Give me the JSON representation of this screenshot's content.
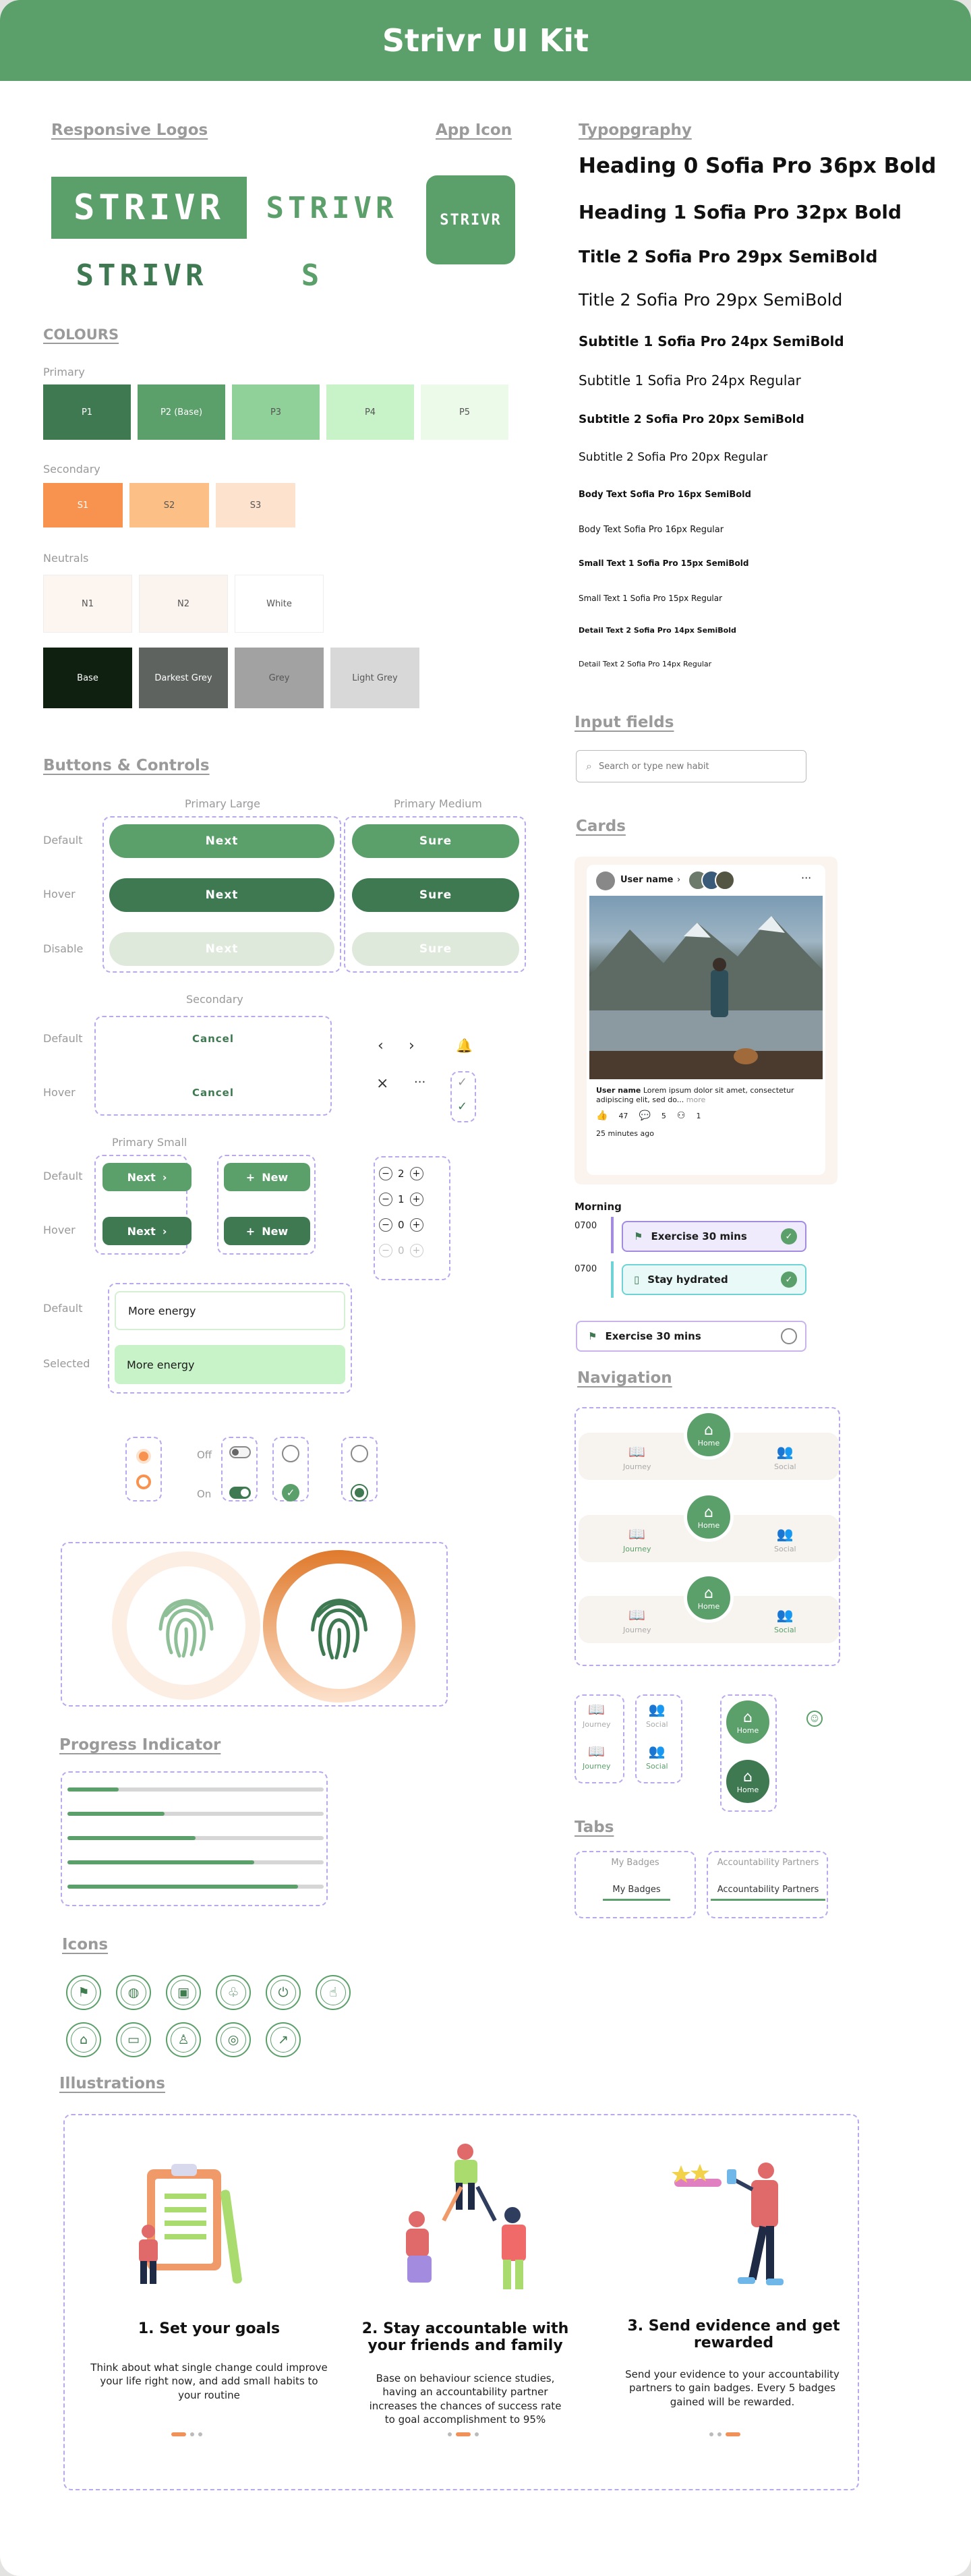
{
  "title": "Strivr UI Kit",
  "colors": {
    "brand": "#5b9f6a",
    "brand_dark": "#3f7d4e",
    "outline": "#b9a8ec"
  },
  "sections": {
    "responsive_logos": "Responsive Logos",
    "app_icon": "App Icon",
    "colours": "COLOURS",
    "typography": "Typopgraphy",
    "buttons": "Buttons & Controls",
    "input_fields": "Input fields",
    "cards": "Cards",
    "navigation": "Navigation",
    "tabs": "Tabs",
    "progress": "Progress Indicator",
    "icons": "Icons",
    "illustrations": "Illustrations"
  },
  "logos": {
    "full": "STRIVR",
    "small": "S"
  },
  "colour_groups": {
    "primary": "Primary",
    "secondary": "Secondary",
    "neutrals": "Neutrals"
  },
  "swatches": {
    "primary": [
      {
        "label": "P1",
        "color": "#3e7952"
      },
      {
        "label": "P2 (Base)",
        "color": "#5b9f6a"
      },
      {
        "label": "P3",
        "color": "#90d199"
      },
      {
        "label": "P4",
        "color": "#c8f3c8"
      },
      {
        "label": "P5",
        "color": "#ecfbe9"
      }
    ],
    "secondary": [
      {
        "label": "S1",
        "color": "#f8924f"
      },
      {
        "label": "S2",
        "color": "#fcc087"
      },
      {
        "label": "S3",
        "color": "#fde2cd"
      }
    ],
    "neutrals": [
      {
        "label": "N1",
        "color": "#fdf5f0"
      },
      {
        "label": "N2",
        "color": "#fbf3ee"
      },
      {
        "label": "White",
        "color": "#ffffff"
      }
    ],
    "neutrals_dark": [
      {
        "label": "Base",
        "color": "#0f1f10"
      },
      {
        "label": "Darkest Grey",
        "color": "#5f6360"
      },
      {
        "label": "Grey",
        "color": "#a2a2a2"
      },
      {
        "label": "Light Grey",
        "color": "#d8d8d8"
      }
    ]
  },
  "typography": [
    "Heading 0 Sofia Pro 36px Bold",
    "Heading 1 Sofia Pro 32px Bold",
    "Title 2 Sofia Pro 29px SemiBold",
    "Title 2 Sofia Pro 29px SemiBold",
    "Subtitle 1 Sofia Pro 24px SemiBold",
    "Subtitle 1 Sofia Pro 24px Regular",
    "Subtitle 2 Sofia Pro 20px SemiBold",
    "Subtitle 2 Sofia Pro 20px Regular",
    "Body Text Sofia Pro 16px SemiBold",
    "Body Text Sofia Pro 16px Regular",
    "Small Text 1 Sofia Pro 15px SemiBold",
    "Small Text 1 Sofia Pro 15px Regular",
    "Detail Text 2 Sofia Pro 14px SemiBold",
    "Detail Text 2 Sofia Pro 14px Regular"
  ],
  "input": {
    "placeholder": "Search or type new habit"
  },
  "buttons": {
    "primary_large": "Primary Large",
    "primary_medium": "Primary Medium",
    "secondary": "Secondary",
    "primary_small": "Primary Small",
    "states": {
      "default": "Default",
      "hover": "Hover",
      "disable": "Disable",
      "selected": "Selected"
    },
    "next": "Next",
    "sure": "Sure",
    "cancel": "Cancel",
    "new": "New",
    "more_energy": "More energy",
    "off": "Off",
    "on": "On",
    "counters": [
      "2",
      "1",
      "0",
      "0"
    ]
  },
  "card": {
    "user": "User name",
    "caption_user": "User name",
    "caption": "Lorem ipsum dolor sit amet, consectetur adipiscing elit, sed do...",
    "more": "more",
    "likes": "47",
    "comments": "5",
    "shares": "1",
    "time": "25 minutes ago"
  },
  "habits": {
    "morning": "Morning",
    "time1": "0700",
    "time2": "0700",
    "h1": "Exercise 30 mins",
    "h2": "Stay hydrated",
    "h3": "Exercise 30 mins"
  },
  "nav": {
    "journey": "Journey",
    "home": "Home",
    "social": "Social"
  },
  "tabs": {
    "badges": "My Badges",
    "partners": "Accountability Partners"
  },
  "progress": [
    0.2,
    0.38,
    0.5,
    0.73,
    0.9
  ],
  "icons": [
    "run-icon",
    "globe-icon",
    "frame-icon",
    "plant-icon",
    "power-icon",
    "thumbs-up-icon",
    "mortarboard-icon",
    "briefcase-icon",
    "person-icon",
    "meditation-icon",
    "growth-icon"
  ],
  "illustrations": [
    {
      "title": "1. Set your goals",
      "text": "Think about what single change could improve your life right now, and add small habits to your routine"
    },
    {
      "title": "2. Stay accountable with your friends and family",
      "text": "Base on behaviour science studies, having an accountability partner increases the chances of success rate to goal accomplishment to 95%"
    },
    {
      "title": "3. Send evidence and get rewarded",
      "text": "Send your evidence to your accountability partners to gain badges. Every 5 badges gained will be rewarded."
    }
  ]
}
